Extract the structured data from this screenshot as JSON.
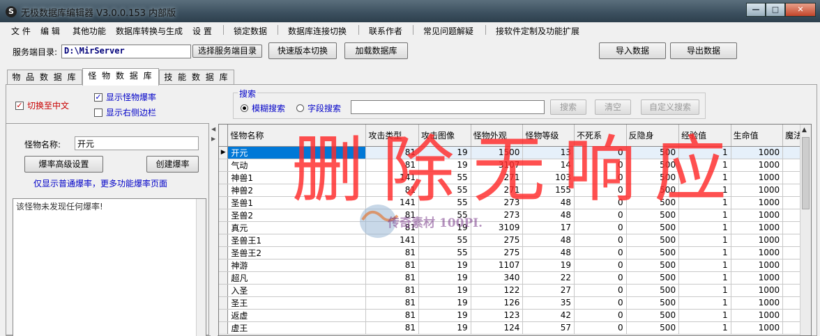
{
  "window": {
    "app_icon": "S",
    "title": "无极数据库编辑器 V3.0.0.153 内部版",
    "buttons": {
      "minimize": "—",
      "maximize": "□",
      "close": "✕"
    }
  },
  "menu": [
    "文 件",
    "编 辑",
    "其他功能",
    "数据库转换与生成",
    "设 置",
    "锁定数据",
    "数据库连接切换",
    "联系作者",
    "常见问题解疑",
    "接软件定制及功能扩展"
  ],
  "server": {
    "label": "服务端目录:",
    "path": "D:\\MirServer",
    "browse_button": "选择服务端目录",
    "switch_button": "快速版本切换",
    "load_button": "加载数据库",
    "import_button": "导入数据",
    "export_button": "导出数据"
  },
  "tabs": [
    "物 品 数 据 库",
    "怪 物 数 据 库",
    "技 能 数 据 库"
  ],
  "options": {
    "switch_chinese": "切换至中文",
    "show_drop_rate": "显示怪物爆率",
    "show_right_sidebar": "显示右侧边栏"
  },
  "search": {
    "group_title": "搜索",
    "fuzzy": "模糊搜索",
    "field": "字段搜索",
    "search_button": "搜索",
    "clear_button": "清空",
    "custom_button": "自定义搜索",
    "value": ""
  },
  "left_panel": {
    "monster_name_label": "怪物名称:",
    "monster_name_value": "开元",
    "advanced_button": "爆率高级设置",
    "create_button": "创建爆率",
    "note": "仅显示普通爆率，更多功能爆率页面",
    "memo_text": "该怪物未发现任何爆率!"
  },
  "grid": {
    "columns": [
      "怪物名称",
      "攻击类型",
      "攻击图像",
      "怪物外观",
      "怪物等级",
      "不死系",
      "反隐身",
      "经验值",
      "生命值",
      "魔法"
    ],
    "rows": [
      [
        "开元",
        "81",
        "19",
        "1500",
        "13",
        "0",
        "500",
        "1",
        "1000"
      ],
      [
        "气动",
        "81",
        "19",
        "3107",
        "14",
        "0",
        "500",
        "1",
        "1000"
      ],
      [
        "神兽1",
        "141",
        "55",
        "271",
        "103",
        "0",
        "500",
        "1",
        "1000"
      ],
      [
        "神兽2",
        "81",
        "55",
        "271",
        "155",
        "0",
        "500",
        "1",
        "1000"
      ],
      [
        "圣兽1",
        "141",
        "55",
        "273",
        "48",
        "0",
        "500",
        "1",
        "1000"
      ],
      [
        "圣兽2",
        "81",
        "55",
        "273",
        "48",
        "0",
        "500",
        "1",
        "1000"
      ],
      [
        "真元",
        "81",
        "19",
        "3109",
        "17",
        "0",
        "500",
        "1",
        "1000"
      ],
      [
        "圣兽王1",
        "141",
        "55",
        "275",
        "48",
        "0",
        "500",
        "1",
        "1000"
      ],
      [
        "圣兽王2",
        "81",
        "55",
        "275",
        "48",
        "0",
        "500",
        "1",
        "1000"
      ],
      [
        "神游",
        "81",
        "19",
        "1107",
        "19",
        "0",
        "500",
        "1",
        "1000"
      ],
      [
        "超凡",
        "81",
        "19",
        "340",
        "22",
        "0",
        "500",
        "1",
        "1000"
      ],
      [
        "入圣",
        "81",
        "19",
        "122",
        "27",
        "0",
        "500",
        "1",
        "1000"
      ],
      [
        "圣王",
        "81",
        "19",
        "126",
        "35",
        "0",
        "500",
        "1",
        "1000"
      ],
      [
        "返虚",
        "81",
        "19",
        "123",
        "42",
        "0",
        "500",
        "1",
        "1000"
      ],
      [
        "虚王",
        "81",
        "19",
        "124",
        "57",
        "0",
        "500",
        "1",
        "1000"
      ]
    ],
    "row_indicator": "▶"
  },
  "annotation": {
    "handwriting": "删除无响应",
    "watermark": "传奇素材 100PI.COM"
  }
}
